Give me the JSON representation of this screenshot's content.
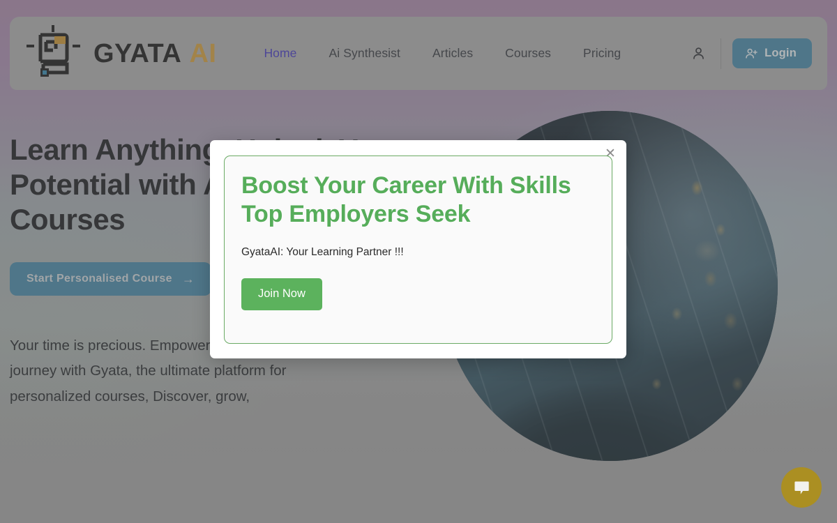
{
  "brand": {
    "name_dark": "GYATA",
    "name_accent": "AI",
    "logo_icon": "robot-circuit-logo",
    "accent_color": "#c89434"
  },
  "nav": {
    "items": [
      {
        "label": "Home",
        "active": true
      },
      {
        "label": "Ai Synthesist",
        "active": false
      },
      {
        "label": "Articles",
        "active": false
      },
      {
        "label": "Courses",
        "active": false
      },
      {
        "label": "Pricing",
        "active": false
      }
    ],
    "active_color": "#3b30b8"
  },
  "header_actions": {
    "account_icon": "user-icon",
    "login_label": "Login",
    "login_icon": "user-plus-icon",
    "login_color": "#3e7f9e"
  },
  "hero": {
    "title": "Learn Anything, Unlock Your Potential with AI Powered Courses",
    "cta_label": "Start Personalised Course",
    "cta_arrow": "→",
    "cta_color": "#3e7f9e",
    "paragraph": "Your time is precious. Empower your learning journey with Gyata, the ultimate platform for personalized courses, Discover, grow,",
    "image_alt": "person-in-server-room-photo"
  },
  "modal": {
    "title": "Boost Your Career With Skills Top Employers Seek",
    "subtitle": "GyataAI: Your Learning Partner !!!",
    "join_label": "Join Now",
    "close_icon": "close-icon",
    "close_glyph": "✕",
    "title_color": "#56ad5a",
    "button_color": "#5cb25d",
    "border_color": "#6aaa64"
  },
  "chat_widget": {
    "icon": "chat-bubble-icon",
    "color": "#ab8f22"
  }
}
